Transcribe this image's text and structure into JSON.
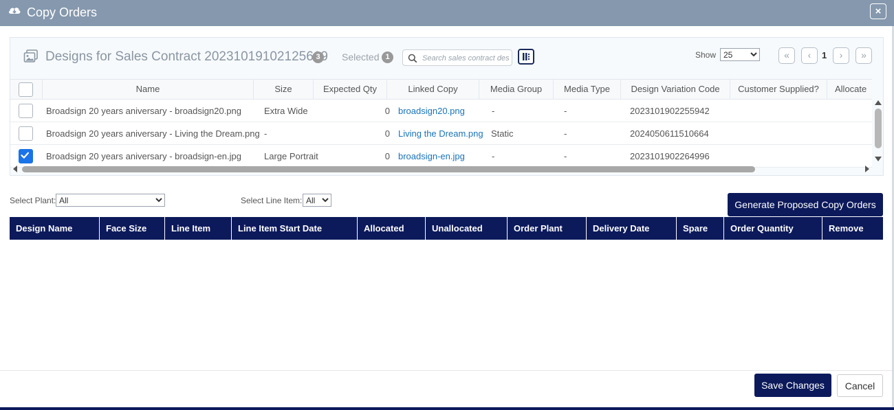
{
  "dialog": {
    "title": "Copy Orders",
    "close_label": "×"
  },
  "designs": {
    "title": "Designs for Sales Contract 20231019102125619",
    "count": "3",
    "selected_label": "Selected",
    "selected_count": "1",
    "search_placeholder": "Search sales contract desi",
    "show_label": "Show",
    "page_size": "25",
    "page_size_options": [
      "25"
    ],
    "page": "1",
    "pager": {
      "first": "«",
      "prev": "‹",
      "next": "›",
      "last": "»"
    },
    "columns": [
      "Name",
      "Size",
      "Expected Qty",
      "Linked Copy",
      "Media Group",
      "Media Type",
      "Design Variation Code",
      "Customer Supplied?",
      "Allocate"
    ],
    "rows": [
      {
        "checked": false,
        "name": "Broadsign 20 years aniversary - broadsign20.png",
        "size": "Extra Wide",
        "expected_qty": "0",
        "linked_copy": "broadsign20.png",
        "media_group": "-",
        "media_type": "-",
        "variation_code": "2023101902255942"
      },
      {
        "checked": false,
        "name": "Broadsign 20 years aniversary - Living the Dream.png",
        "size": "-",
        "expected_qty": "0",
        "linked_copy": "Living the Dream.png",
        "media_group": "Static",
        "media_type": "-",
        "variation_code": "2024050611510664"
      },
      {
        "checked": true,
        "name": "Broadsign 20 years aniversary - broadsign-en.jpg",
        "size": "Large Portrait",
        "expected_qty": "0",
        "linked_copy": "broadsign-en.jpg",
        "media_group": "-",
        "media_type": "-",
        "variation_code": "2023101902264996"
      }
    ]
  },
  "filters": {
    "plant_label": "Select Plant:",
    "plant_value": "All",
    "line_item_label": "Select Line Item:",
    "line_item_value": "All",
    "generate_label": "Generate Proposed Copy Orders"
  },
  "orders": {
    "columns": [
      "Design Name",
      "Face Size",
      "Line Item",
      "Line Item Start Date",
      "Allocated",
      "Unallocated",
      "Order Plant",
      "Delivery Date",
      "Spare",
      "Order Quantity",
      "Remove"
    ]
  },
  "footer": {
    "save_label": "Save Changes",
    "cancel_label": "Cancel"
  },
  "colors": {
    "titlebar": "#8598ad",
    "navy": "#0c1a5b",
    "link": "#1a73b8",
    "checkbox_on": "#1a73e8"
  }
}
